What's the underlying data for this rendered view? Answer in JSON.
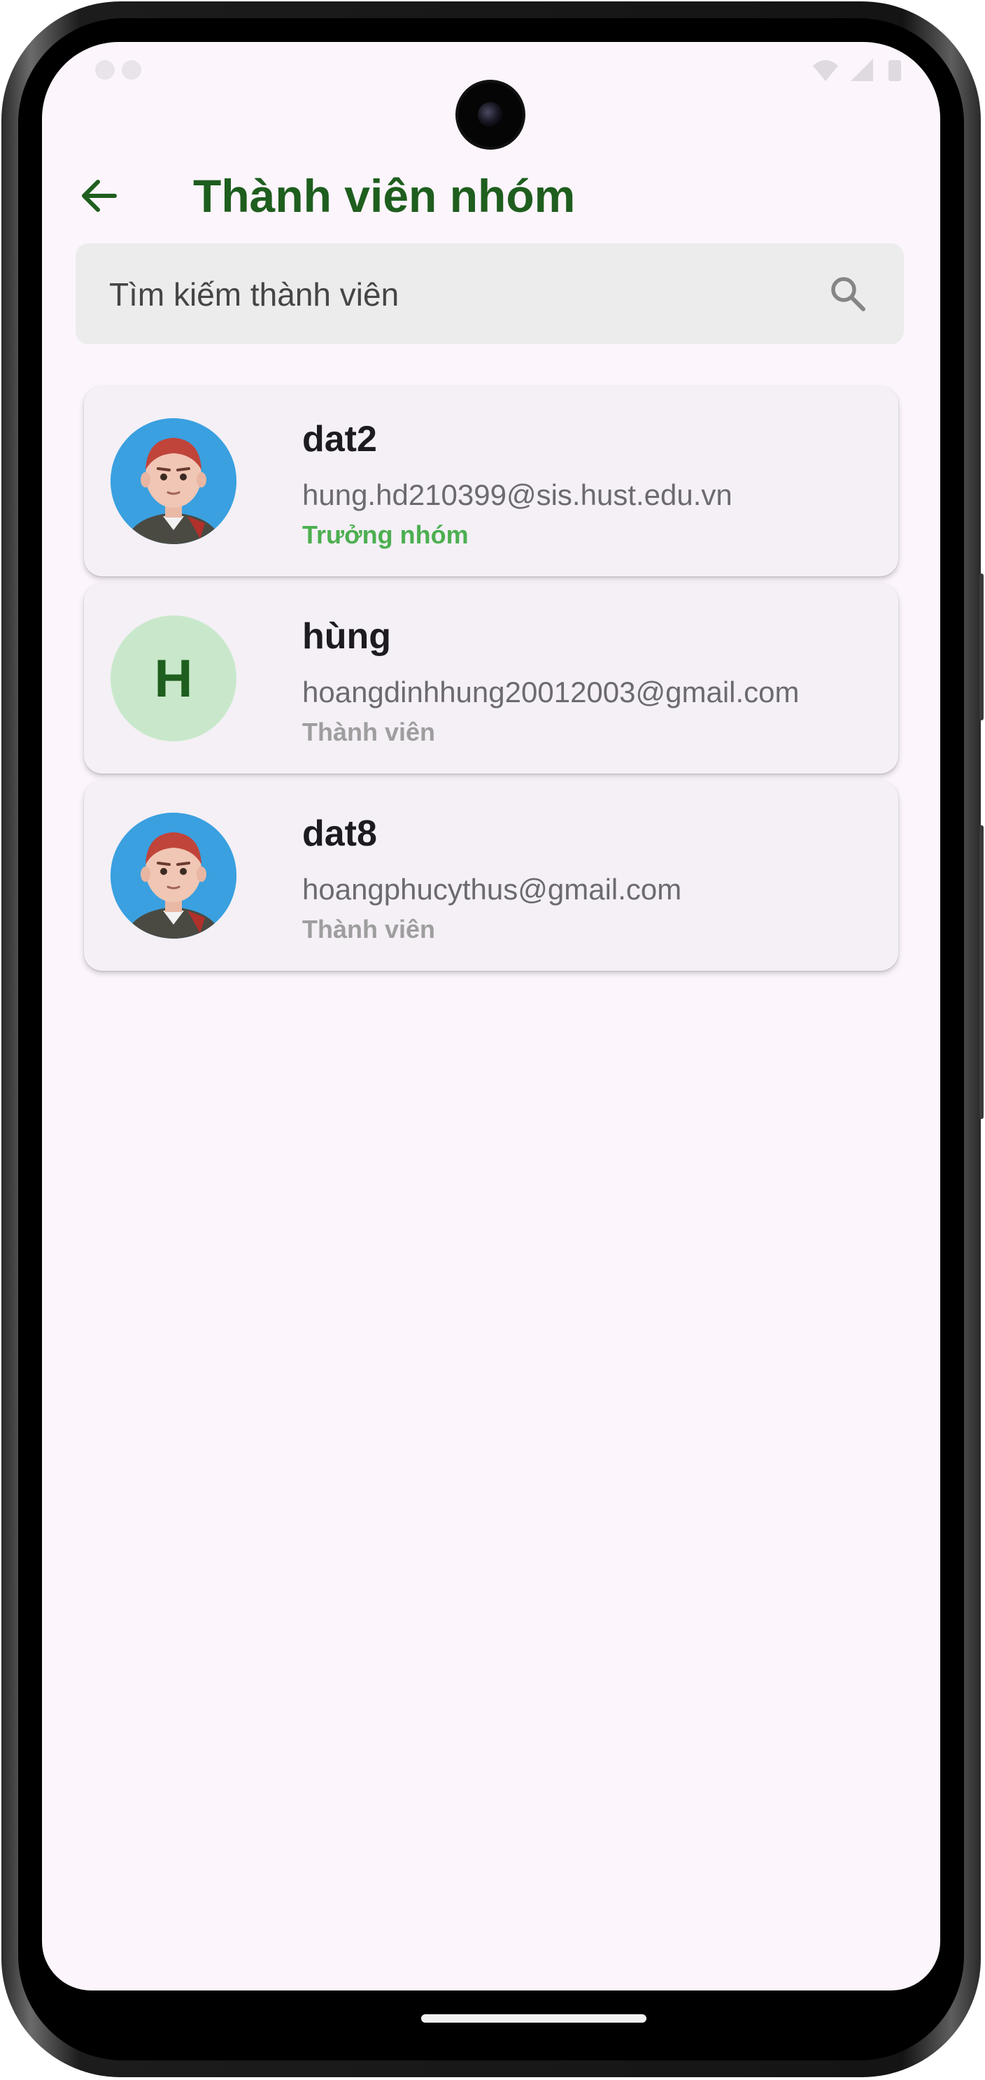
{
  "header": {
    "title": "Thành viên nhóm",
    "back_icon": "arrow-back-icon"
  },
  "search": {
    "placeholder": "Tìm kiếm thành viên",
    "icon": "search-icon"
  },
  "colors": {
    "title": "#1e5e1e",
    "leader_role": "#4caf50",
    "member_role": "#9e9e9e",
    "card_background": "#f4f0f6",
    "screen_background": "#fcf5fc"
  },
  "members": [
    {
      "name": "dat2",
      "email": "hung.hd210399@sis.hust.edu.vn",
      "role": "Trưởng nhóm",
      "avatar": "3d-character-avatar"
    },
    {
      "name": "hùng",
      "email": "hoangdinhhung20012003@gmail.com",
      "role": "Thành viên",
      "avatar_initial": "H"
    },
    {
      "name": "dat8",
      "email": "hoangphucythus@gmail.com",
      "role": "Thành viên",
      "avatar": "3d-character-avatar"
    }
  ]
}
